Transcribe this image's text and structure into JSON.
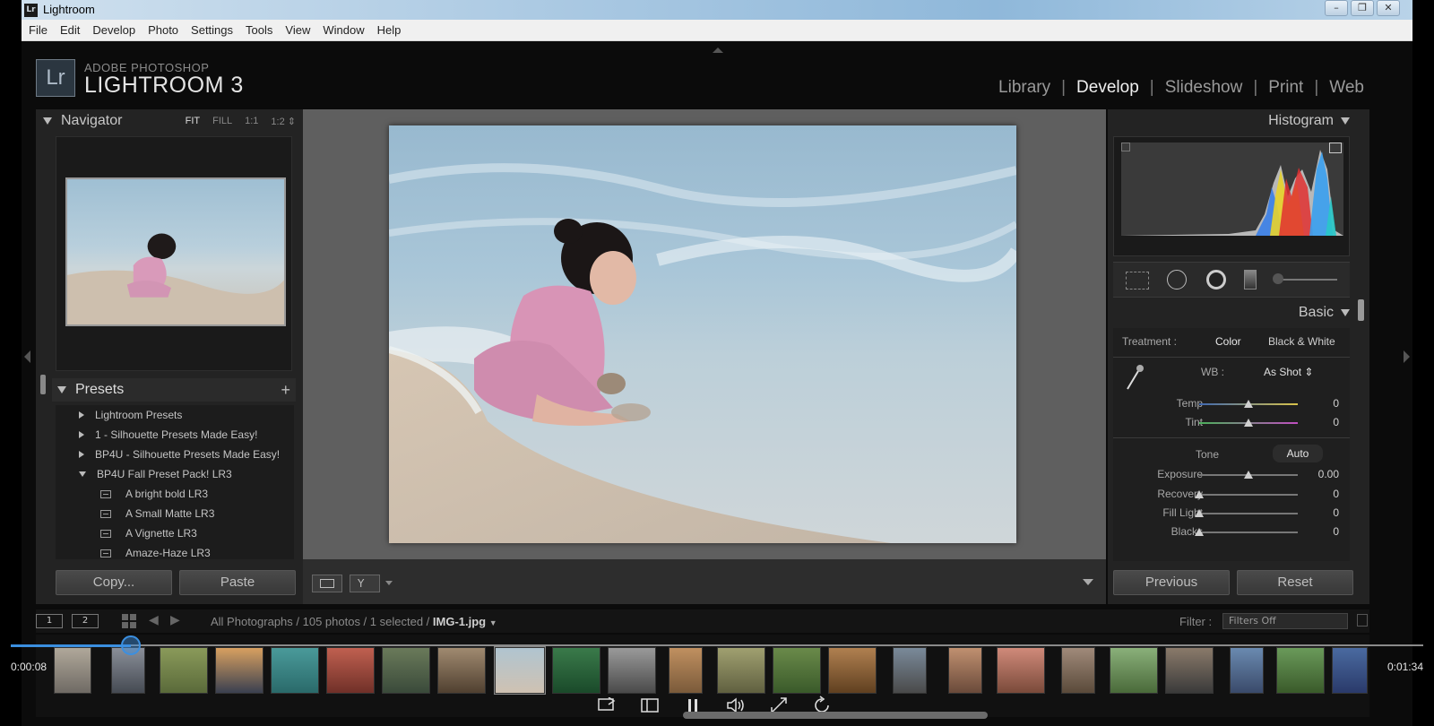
{
  "window": {
    "icon_text": "Lr",
    "title": "Lightroom",
    "controls": [
      "–",
      "❐",
      "✕"
    ]
  },
  "menu": [
    "File",
    "Edit",
    "Develop",
    "Photo",
    "Settings",
    "Tools",
    "View",
    "Window",
    "Help"
  ],
  "logo": {
    "box": "Lr",
    "adobe": "ADOBE PHOTOSHOP",
    "name": "LIGHTROOM 3"
  },
  "modules": [
    {
      "label": "Library",
      "active": false
    },
    {
      "label": "Develop",
      "active": true
    },
    {
      "label": "Slideshow",
      "active": false
    },
    {
      "label": "Print",
      "active": false
    },
    {
      "label": "Web",
      "active": false
    }
  ],
  "module_separator": "|",
  "navigator": {
    "title": "Navigator",
    "zoom_options": [
      "FIT",
      "FILL",
      "1:1",
      "1:2 ⇕"
    ]
  },
  "presets": {
    "title": "Presets",
    "add": "+",
    "items": [
      {
        "label": "Lightroom Presets",
        "kind": "folder-collapsed"
      },
      {
        "label": "1 - Silhouette Presets Made Easy!",
        "kind": "folder-collapsed"
      },
      {
        "label": "BP4U - Silhouette Presets Made Easy!",
        "kind": "folder-collapsed"
      },
      {
        "label": "BP4U Fall Preset Pack! LR3",
        "kind": "folder-expanded"
      },
      {
        "label": "A bright bold LR3",
        "kind": "preset"
      },
      {
        "label": "A Small Matte LR3",
        "kind": "preset"
      },
      {
        "label": "A Vignette LR3",
        "kind": "preset"
      },
      {
        "label": "Amaze-Haze LR3",
        "kind": "preset"
      }
    ]
  },
  "left_buttons": {
    "copy": "Copy...",
    "paste": "Paste"
  },
  "histogram": {
    "title": "Histogram"
  },
  "basic": {
    "title": "Basic",
    "treatment_label": "Treatment :",
    "treatment_color": "Color",
    "treatment_bw": "Black & White",
    "wb_label": "WB :",
    "wb_value": "As Shot ⇕",
    "tone_label": "Tone",
    "tone_auto": "Auto",
    "sliders": [
      {
        "label": "Temp",
        "value": "0",
        "pos": 0.5
      },
      {
        "label": "Tint",
        "value": "0",
        "pos": 0.5
      },
      {
        "label": "Exposure",
        "value": "0.00",
        "pos": 0.5
      },
      {
        "label": "Recovery",
        "value": "0",
        "pos": 0.0
      },
      {
        "label": "Fill Light",
        "value": "0",
        "pos": 0.0
      },
      {
        "label": "Blacks",
        "value": "0",
        "pos": 0.0
      }
    ]
  },
  "right_buttons": {
    "previous": "Previous",
    "reset": "Reset"
  },
  "filmstrip": {
    "page1": "1",
    "page2": "2",
    "path_prefix": "All Photographs / 105 photos / 1 selected /",
    "path_file": "IMG-1.jpg",
    "filter_label": "Filter :",
    "filter_value": "Filters Off"
  },
  "player": {
    "elapsed": "0:00:08",
    "total": "0:01:34",
    "progress": 0.085
  },
  "colors": {
    "accent_blue": "#3b8fe0",
    "panel_bg": "#232323",
    "center_bg": "#5f5f5f"
  }
}
